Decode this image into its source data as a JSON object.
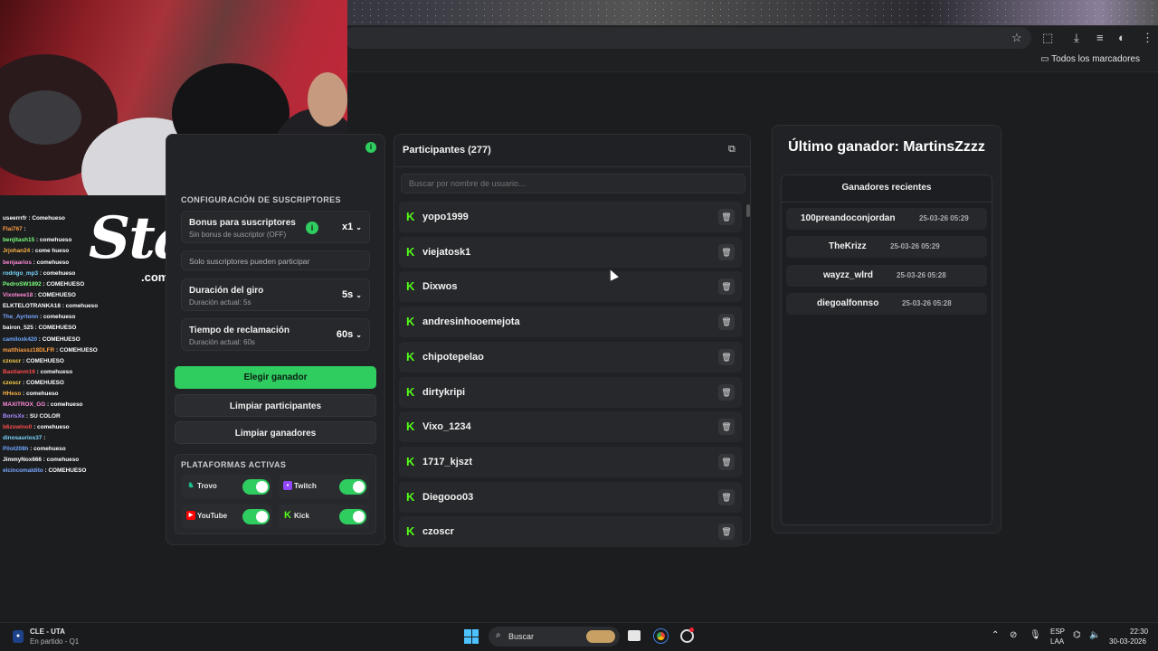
{
  "browser": {
    "bookmarks_all": "Todos los marcadores"
  },
  "chat": [
    {
      "user": "useerrrfr",
      "msg": "Comehueso",
      "color": "#ffffff"
    },
    {
      "user": "Flai767",
      "msg": "",
      "color": "#ff9f40"
    },
    {
      "user": "benjitash15",
      "msg": "comehueso",
      "color": "#7cff7c"
    },
    {
      "user": "Jrjohan24",
      "msg": "come hueso",
      "color": "#ffb347"
    },
    {
      "user": "benjaarios",
      "msg": "comehueso",
      "color": "#ff8ad8"
    },
    {
      "user": "rodrigo_mp3",
      "msg": "comehueso",
      "color": "#7ad7ff"
    },
    {
      "user": "PedroSW1892",
      "msg": "COMEHUESO",
      "color": "#7cff7c"
    },
    {
      "user": "Vixoteee18",
      "msg": "COMEHUESO",
      "color": "#ff8ad8"
    },
    {
      "user": "ELKTELOTRANKA18",
      "msg": "comehueso",
      "color": "#ffffff"
    },
    {
      "user": "The_Ayrtonn",
      "msg": "comehueso",
      "color": "#7aa7ff"
    },
    {
      "user": "bairon_525",
      "msg": "COMEHUESO",
      "color": "#ffffff"
    },
    {
      "user": "camiloxk420",
      "msg": "COMEHUESO",
      "color": "#6fa8ff"
    },
    {
      "user": "matthiassz18DLFR",
      "msg": "COMEHUESO",
      "color": "#ff9f40"
    },
    {
      "user": "czoscr",
      "msg": "COMEHUESO",
      "color": "#ffd24a"
    },
    {
      "user": "Bastianm16",
      "msg": "comehueso",
      "color": "#ff4d4d"
    },
    {
      "user": "czoscr",
      "msg": "COMEHUESO",
      "color": "#ffd24a"
    },
    {
      "user": "HHeso",
      "msg": "comehueso",
      "color": "#ffb347"
    },
    {
      "user": "MAXITROX_GG",
      "msg": "comehueso",
      "color": "#ff8ad8"
    },
    {
      "user": "BorisXx",
      "msg": "SU COLOR",
      "color": "#a98bff"
    },
    {
      "user": "b6zswino0",
      "msg": "comehueso",
      "color": "#ff4d4d"
    },
    {
      "user": "dinosaurios37",
      "msg": "",
      "color": "#7ad7ff"
    },
    {
      "user": "Pilot208h",
      "msg": "comehueso",
      "color": "#6fa8ff"
    },
    {
      "user": "JimmyNox666",
      "msg": "comehueso",
      "color": "#ffffff"
    },
    {
      "user": "elcincomaldito",
      "msg": "COMEHUESO",
      "color": "#7aa7ff"
    }
  ],
  "stake": {
    "logo": "Stake",
    "sub": ".com"
  },
  "config": {
    "section_title": "CONFIGURACIÓN DE SUSCRIPTORES",
    "bonus_title": "Bonus para suscriptores",
    "bonus_sub": "Sin bonus de suscriptor (OFF)",
    "bonus_value": "x1",
    "subs_only": "Solo suscriptores pueden participar",
    "spin_title": "Duración del giro",
    "spin_sub": "Duración actual: 5s",
    "spin_value": "5s",
    "claim_title": "Tiempo de reclamación",
    "claim_sub": "Duración actual: 60s",
    "claim_value": "60s"
  },
  "buttons": {
    "pick_winner": "Elegir ganador",
    "clear_participants": "Limpiar participantes",
    "clear_winners": "Limpiar ganadores"
  },
  "platforms": {
    "section_title": "PLATAFORMAS ACTIVAS",
    "items": [
      {
        "name": "Trovo",
        "color": "#1bbf8a",
        "enabled": true
      },
      {
        "name": "Twitch",
        "color": "#9146ff",
        "enabled": true
      },
      {
        "name": "YouTube",
        "color": "#ff0000",
        "enabled": true
      },
      {
        "name": "Kick",
        "color": "#53fc18",
        "enabled": true
      }
    ]
  },
  "participants": {
    "title": "Participantes (277)",
    "search_placeholder": "Buscar por nombre de usuario...",
    "list": [
      "yopo1999",
      "viejatosk1",
      "Dixwos",
      "andresinhooemejota",
      "chipotepelao",
      "dirtykripi",
      "Vixo_1234",
      "1717_kjszt",
      "Diegooo03",
      "czoscr"
    ]
  },
  "winner": {
    "title": "Último ganador: MartinsZzzz",
    "recent_title": "Ganadores recientes",
    "recent": [
      {
        "name": "100preandoconjordan",
        "time": "25-03-26 05:29"
      },
      {
        "name": "TheKrizz",
        "time": "25-03-26 05:29"
      },
      {
        "name": "wayzz_wlrd",
        "time": "25-03-26 05:28"
      },
      {
        "name": "diegoalfonnso",
        "time": "25-03-26 05:28"
      }
    ]
  },
  "taskbar": {
    "game_title": "CLE - UTA",
    "game_status": "En partido - Q1",
    "search": "Buscar",
    "lang": "ESP",
    "lang2": "LAA",
    "time": "22:30",
    "date": "30-03-2026"
  }
}
